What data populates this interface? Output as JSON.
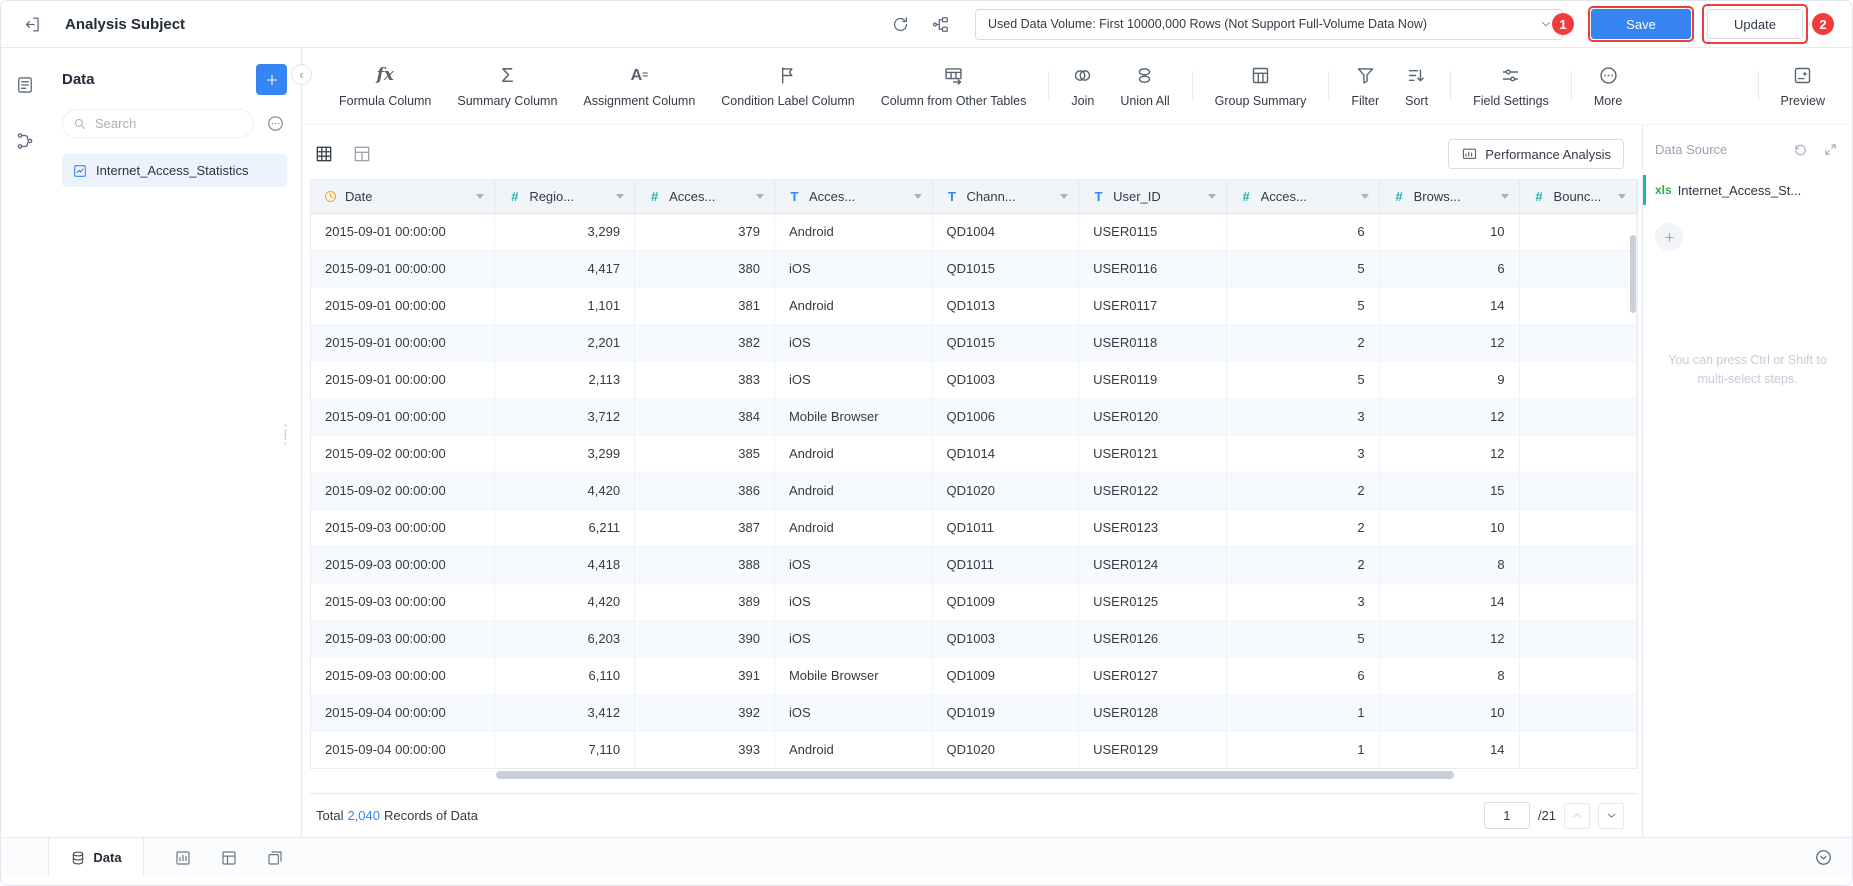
{
  "topbar": {
    "title": "Analysis Subject",
    "data_volume_dropdown": {
      "value": "Used Data Volume: First 10000,000 Rows (Not Support Full-Volume Data Now)"
    },
    "save_button": "Save",
    "update_button": "Update",
    "annotation_badge_1": "1",
    "annotation_badge_2": "2"
  },
  "sidebar": {
    "title": "Data",
    "search": {
      "placeholder": "Search"
    },
    "tables": [
      {
        "label": "Internet_Access_Statistics"
      }
    ]
  },
  "toolbar": {
    "groups": [
      {
        "items": [
          {
            "name": "formula-column",
            "label": "Formula Column",
            "icon": "fx"
          },
          {
            "name": "summary-column",
            "label": "Summary Column",
            "icon": "sigma"
          },
          {
            "name": "assignment-column",
            "label": "Assignment Column",
            "icon": "a-equals"
          },
          {
            "name": "condition-label-column",
            "label": "Condition Label Column",
            "icon": "flag"
          },
          {
            "name": "column-from-other-tables",
            "label": "Column from Other Tables",
            "icon": "table-link"
          }
        ]
      },
      {
        "items": [
          {
            "name": "join",
            "label": "Join",
            "icon": "venn"
          },
          {
            "name": "union-all",
            "label": "Union All",
            "icon": "union"
          }
        ]
      },
      {
        "items": [
          {
            "name": "group-summary",
            "label": "Group Summary",
            "icon": "group-summary"
          }
        ]
      },
      {
        "items": [
          {
            "name": "filter",
            "label": "Filter",
            "icon": "funnel"
          },
          {
            "name": "sort",
            "label": "Sort",
            "icon": "sort"
          }
        ]
      },
      {
        "items": [
          {
            "name": "field-settings",
            "label": "Field Settings",
            "icon": "sliders"
          }
        ]
      },
      {
        "items": [
          {
            "name": "more",
            "label": "More",
            "icon": "more"
          }
        ]
      },
      {
        "push_right": true,
        "items": [
          {
            "name": "preview",
            "label": "Preview",
            "icon": "preview"
          }
        ]
      }
    ]
  },
  "table": {
    "performance_button": "Performance Analysis",
    "columns": [
      {
        "label": "Date",
        "type": "date"
      },
      {
        "label": "Regio...",
        "type": "number"
      },
      {
        "label": "Acces...",
        "type": "number"
      },
      {
        "label": "Acces...",
        "type": "text"
      },
      {
        "label": "Chann...",
        "type": "text"
      },
      {
        "label": "User_ID",
        "type": "text"
      },
      {
        "label": "Acces...",
        "type": "number"
      },
      {
        "label": "Brows...",
        "type": "number"
      },
      {
        "label": "Bounc...",
        "type": "number"
      }
    ],
    "rows": [
      [
        "2015-09-01 00:00:00",
        "3,299",
        "379",
        "Android",
        "QD1004",
        "USER0115",
        "6",
        "10",
        ""
      ],
      [
        "2015-09-01 00:00:00",
        "4,417",
        "380",
        "iOS",
        "QD1015",
        "USER0116",
        "5",
        "6",
        ""
      ],
      [
        "2015-09-01 00:00:00",
        "1,101",
        "381",
        "Android",
        "QD1013",
        "USER0117",
        "5",
        "14",
        ""
      ],
      [
        "2015-09-01 00:00:00",
        "2,201",
        "382",
        "iOS",
        "QD1015",
        "USER0118",
        "2",
        "12",
        ""
      ],
      [
        "2015-09-01 00:00:00",
        "2,113",
        "383",
        "iOS",
        "QD1003",
        "USER0119",
        "5",
        "9",
        ""
      ],
      [
        "2015-09-01 00:00:00",
        "3,712",
        "384",
        "Mobile Browser",
        "QD1006",
        "USER0120",
        "3",
        "12",
        ""
      ],
      [
        "2015-09-02 00:00:00",
        "3,299",
        "385",
        "Android",
        "QD1014",
        "USER0121",
        "3",
        "12",
        ""
      ],
      [
        "2015-09-02 00:00:00",
        "4,420",
        "386",
        "Android",
        "QD1020",
        "USER0122",
        "2",
        "15",
        ""
      ],
      [
        "2015-09-03 00:00:00",
        "6,211",
        "387",
        "Android",
        "QD1011",
        "USER0123",
        "2",
        "10",
        ""
      ],
      [
        "2015-09-03 00:00:00",
        "4,418",
        "388",
        "iOS",
        "QD1011",
        "USER0124",
        "2",
        "8",
        ""
      ],
      [
        "2015-09-03 00:00:00",
        "4,420",
        "389",
        "iOS",
        "QD1009",
        "USER0125",
        "3",
        "14",
        ""
      ],
      [
        "2015-09-03 00:00:00",
        "6,203",
        "390",
        "iOS",
        "QD1003",
        "USER0126",
        "5",
        "12",
        ""
      ],
      [
        "2015-09-03 00:00:00",
        "6,110",
        "391",
        "Mobile Browser",
        "QD1009",
        "USER0127",
        "6",
        "8",
        ""
      ],
      [
        "2015-09-04 00:00:00",
        "3,412",
        "392",
        "iOS",
        "QD1019",
        "USER0128",
        "1",
        "10",
        ""
      ],
      [
        "2015-09-04 00:00:00",
        "7,110",
        "393",
        "Android",
        "QD1020",
        "USER0129",
        "1",
        "14",
        ""
      ]
    ],
    "footer": {
      "total_prefix": "Total",
      "total_count": "2,040",
      "total_suffix": "Records of Data",
      "page_value": "1",
      "page_total": "/21"
    }
  },
  "right_panel": {
    "title": "Data Source",
    "source": {
      "badge": "xls",
      "label": "Internet_Access_St..."
    },
    "hint_line1": "You can press Ctrl or Shift to",
    "hint_line2": "multi-select steps."
  },
  "bottombar": {
    "data_tab": "Data"
  },
  "colors": {
    "accent_blue": "#3685F2",
    "annotation_red": "#F23C3C",
    "number_type_teal": "#1FB5AD",
    "text_type_blue": "#3685F2",
    "date_type_orange": "#F5A623",
    "xls_green": "#2EA94F"
  }
}
